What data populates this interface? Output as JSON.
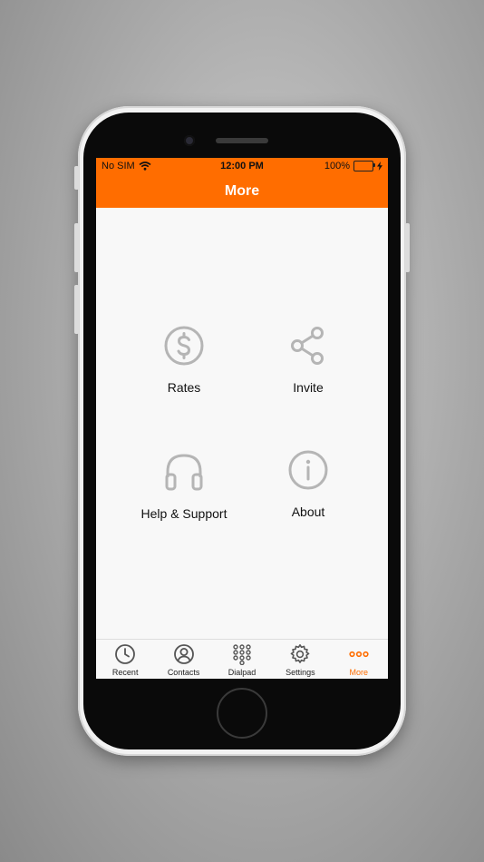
{
  "status_bar": {
    "carrier": "No SIM",
    "time": "12:00 PM",
    "battery": "100%"
  },
  "nav": {
    "title": "More"
  },
  "tiles": [
    {
      "label": "Rates",
      "icon": "dollar-circle-icon"
    },
    {
      "label": "Invite",
      "icon": "share-icon"
    },
    {
      "label": "Help & Support",
      "icon": "headphones-icon"
    },
    {
      "label": "About",
      "icon": "info-circle-icon"
    }
  ],
  "tabs": [
    {
      "label": "Recent",
      "icon": "clock-icon"
    },
    {
      "label": "Contacts",
      "icon": "contact-icon"
    },
    {
      "label": "Dialpad",
      "icon": "dialpad-icon"
    },
    {
      "label": "Settings",
      "icon": "gear-icon"
    },
    {
      "label": "More",
      "icon": "more-dots-icon",
      "active": true
    }
  ],
  "colors": {
    "accent": "#ff6d00",
    "icon_gray": "#b5b5b5",
    "tab_icon": "#555555"
  }
}
